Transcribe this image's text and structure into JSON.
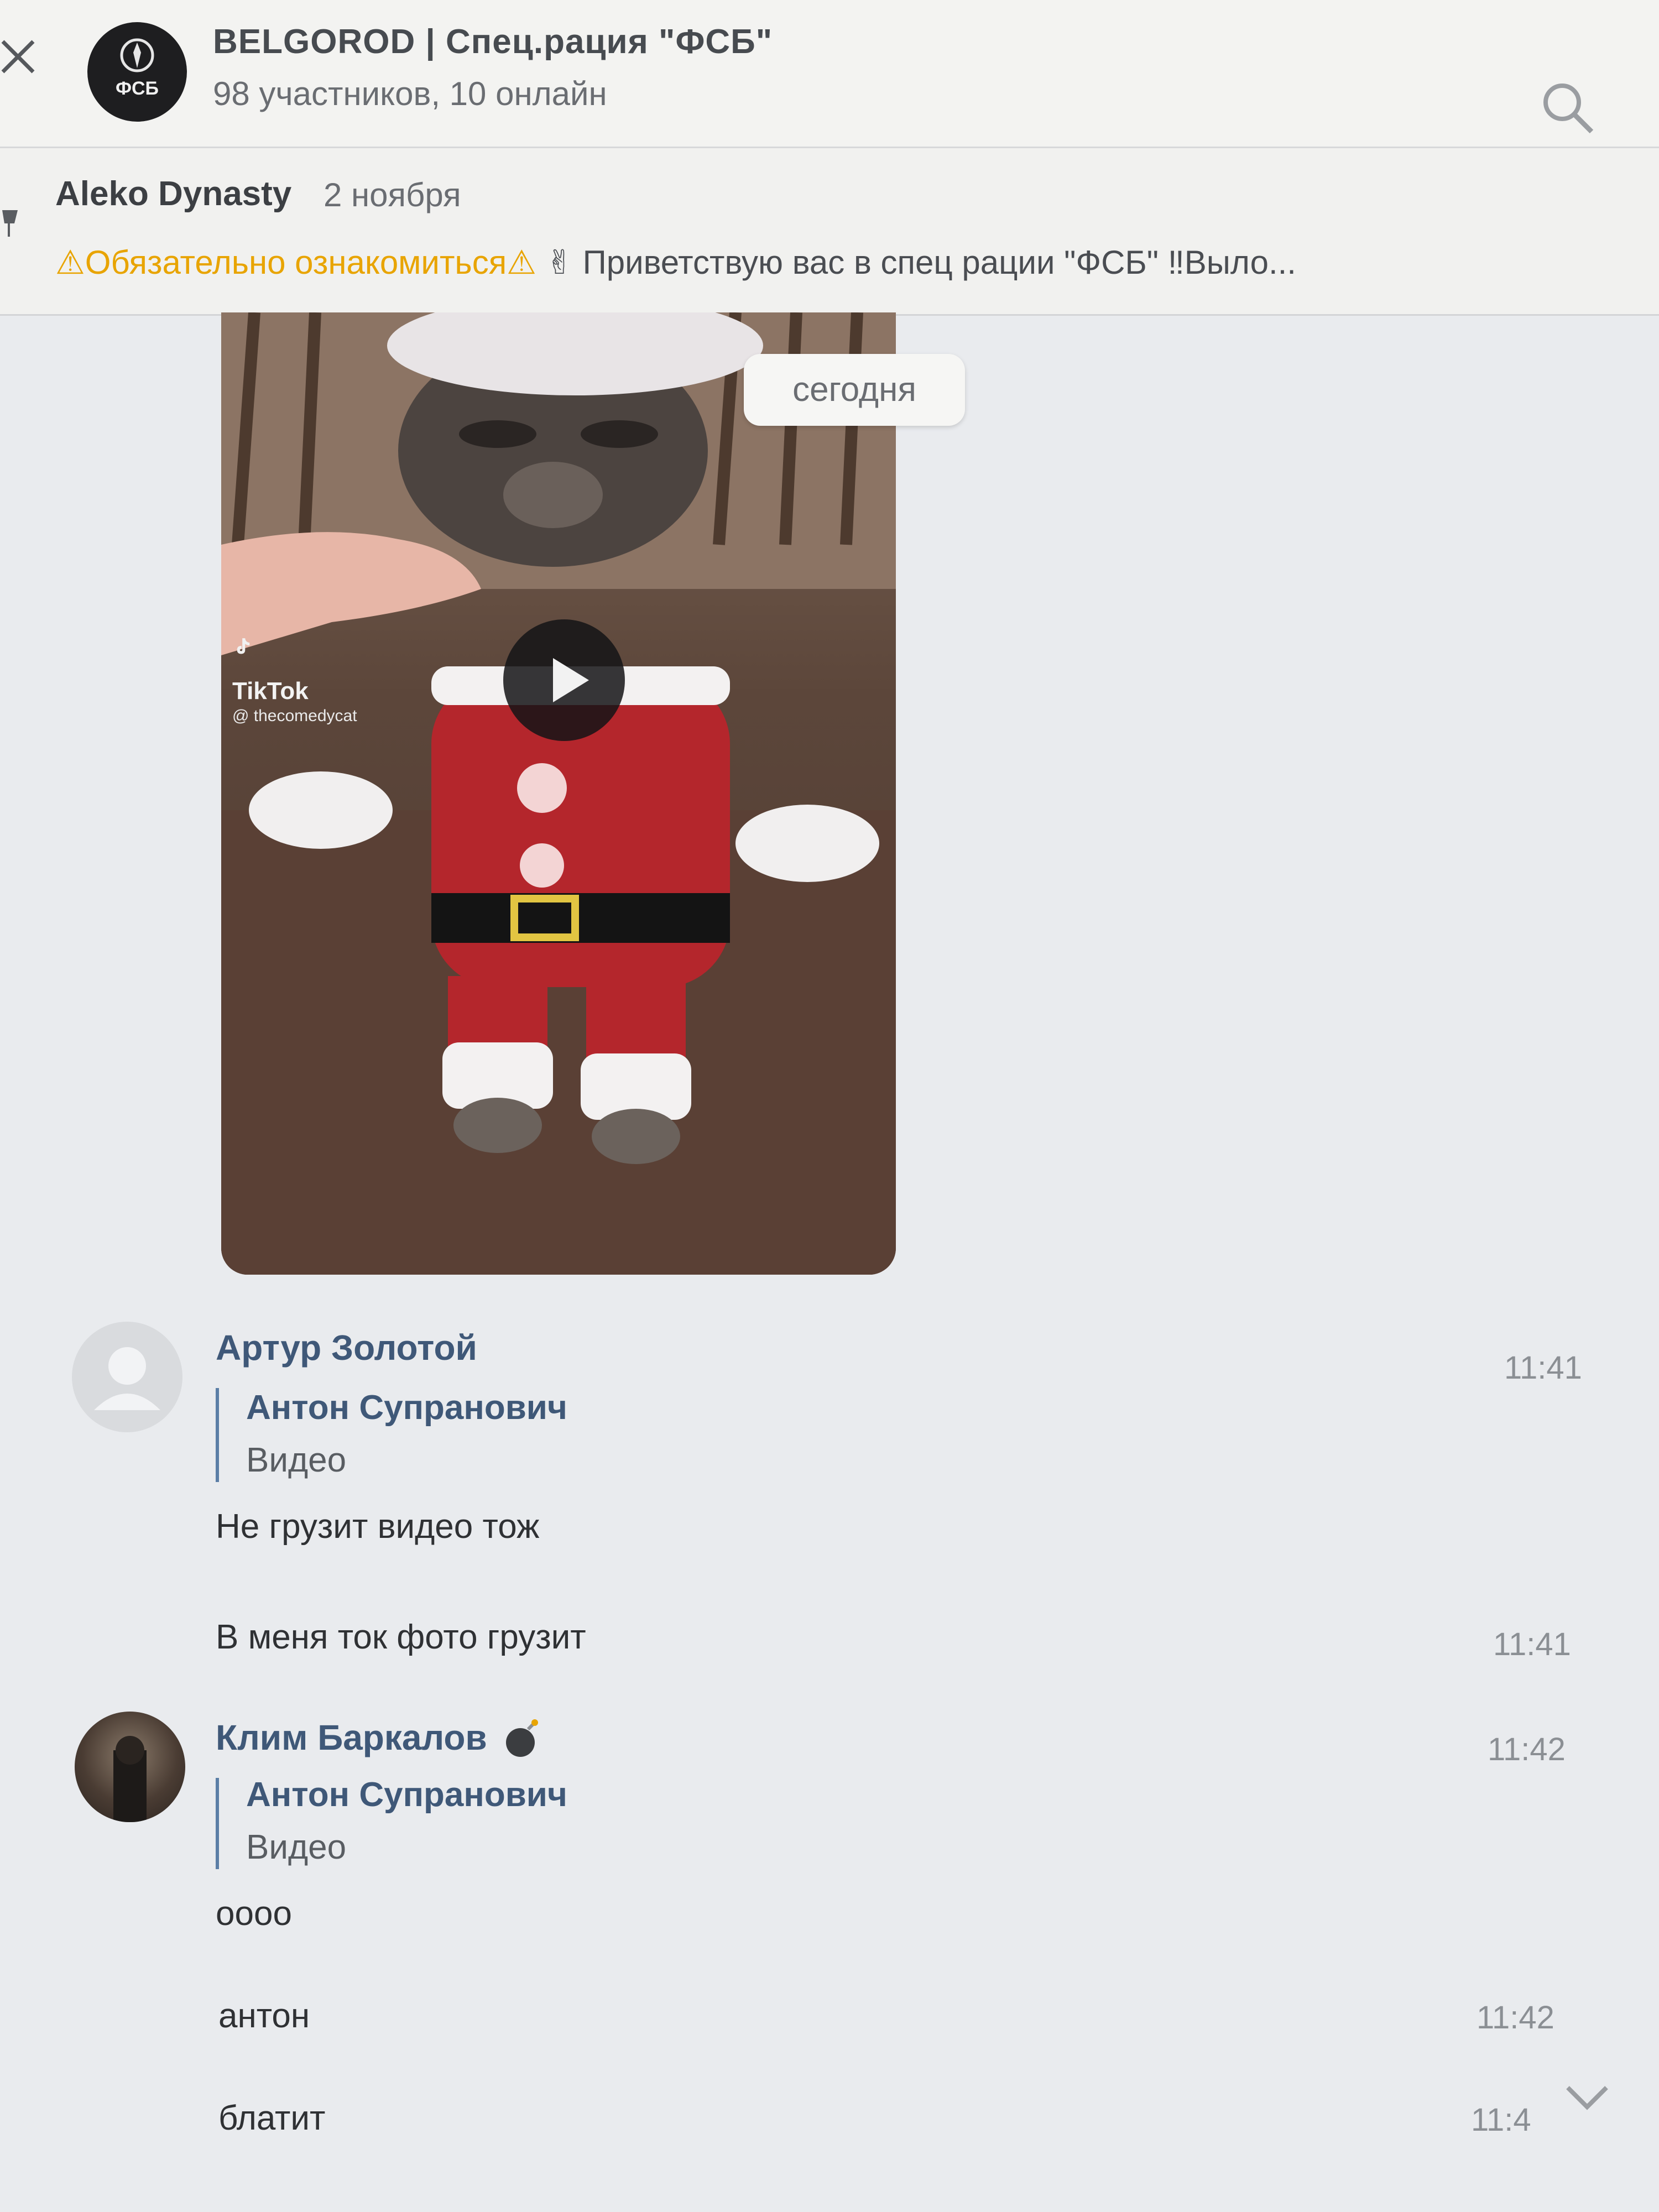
{
  "header": {
    "title": "BELGOROD | Спец.рация \"ФСБ\"",
    "subtitle": "98 участников, 10 онлайн",
    "avatar_text": "ФСБ"
  },
  "pinned": {
    "author": "Aleko Dynasty",
    "date": "2 ноября",
    "text_part1": "⚠Обязательно ознакомиться⚠",
    "text_part2": " ✌ Приветствую вас в спец рации \"ФСБ\" ‼Выло..."
  },
  "feed": {
    "date_badge": "сегодня",
    "video": {
      "watermark_brand": "TikTok",
      "watermark_handle": "@ thecomedycat"
    },
    "messages": [
      {
        "author": "Артур Золотой",
        "time": "11:41",
        "reply": {
          "author": "Антон Супранович",
          "text": "Видео"
        },
        "text": "Не грузит видео тож"
      },
      {
        "text": "В меня ток фото грузит",
        "time": "11:41"
      },
      {
        "author": "Клим Баркалов",
        "author_badge": "💣",
        "time": "11:42",
        "reply": {
          "author": "Антон Супранович",
          "text": "Видео"
        },
        "text": "оооо"
      },
      {
        "text": "антон",
        "time": "11:42"
      },
      {
        "text": "блатит",
        "time": "11:4"
      }
    ]
  },
  "colors": {
    "accent": "#3f5878",
    "quote_bar": "#5b7ea6",
    "background": "#e9ebee"
  }
}
